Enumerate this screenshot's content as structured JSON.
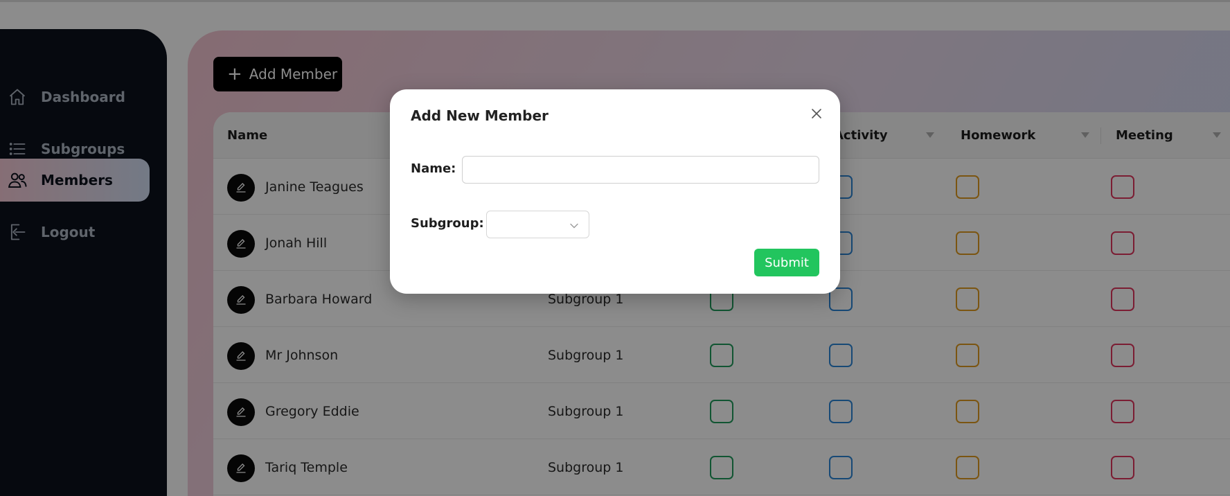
{
  "sidebar": {
    "items": [
      {
        "label": "Dashboard",
        "icon": "home-icon",
        "active": false
      },
      {
        "label": "Subgroups",
        "icon": "list-icon",
        "active": false
      },
      {
        "label": "Members",
        "icon": "users-icon",
        "active": true
      },
      {
        "label": "Logout",
        "icon": "logout-icon",
        "active": false
      }
    ]
  },
  "toolbar": {
    "add_member_label": "Add Member"
  },
  "table": {
    "columns": [
      "Name",
      "Activity",
      "Homework",
      "Meeting"
    ],
    "rows": [
      {
        "name": "Janine Teagues",
        "subgroup": ""
      },
      {
        "name": "Jonah Hill",
        "subgroup": ""
      },
      {
        "name": "Barbara Howard",
        "subgroup": "Subgroup 1"
      },
      {
        "name": "Mr Johnson",
        "subgroup": "Subgroup 1"
      },
      {
        "name": "Gregory Eddie",
        "subgroup": "Subgroup 1"
      },
      {
        "name": "Tariq Temple",
        "subgroup": "Subgroup 1"
      }
    ]
  },
  "modal": {
    "title": "Add New Member",
    "name_label": "Name:",
    "name_value": "",
    "subgroup_label": "Subgroup:",
    "subgroup_value": "",
    "submit_label": "Submit"
  },
  "colors": {
    "sidebar_bg": "#0b111c",
    "submit_bg": "#22c55e",
    "check_green": "#1f9b5b",
    "check_blue": "#2a86d8",
    "check_orange": "#e19b1f",
    "check_pink": "#e0365d"
  }
}
